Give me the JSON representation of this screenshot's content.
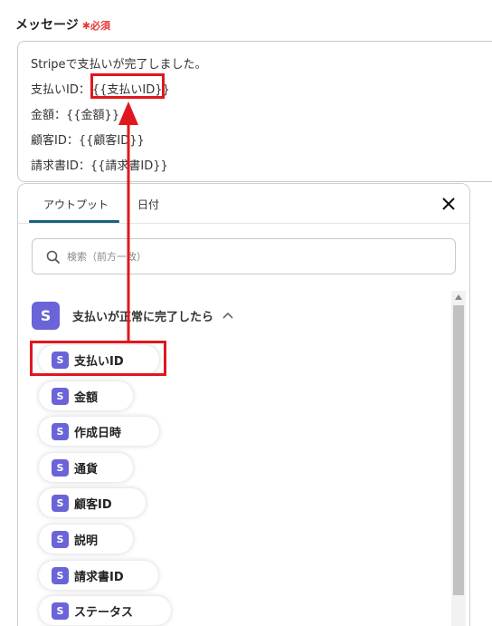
{
  "field": {
    "label": "メッセージ",
    "required_mark": "✱",
    "required_text": "必須"
  },
  "message": {
    "lines": [
      {
        "label": "Stripeで支払いが完了しました。",
        "token": ""
      },
      {
        "label": "支払いID：",
        "token": "{{支払いID}}"
      },
      {
        "label": "金額：",
        "token": "{{金額}}"
      },
      {
        "label": "顧客ID：",
        "token": "{{顧客ID}}"
      },
      {
        "label": "請求書ID：",
        "token": "{{請求書ID}}"
      }
    ]
  },
  "popup": {
    "tabs": [
      {
        "label": "アウトプット",
        "active": true
      },
      {
        "label": "日付",
        "active": false
      }
    ],
    "close_icon": "close-icon",
    "search": {
      "placeholder": "検索（前方一致）",
      "value": ""
    },
    "group": {
      "badge": "S",
      "title": "支払いが正常に完了したら",
      "expanded": true
    },
    "items": [
      {
        "badge": "S",
        "label": "支払いID"
      },
      {
        "badge": "S",
        "label": "金額"
      },
      {
        "badge": "S",
        "label": "作成日時"
      },
      {
        "badge": "S",
        "label": "通貨"
      },
      {
        "badge": "S",
        "label": "顧客ID"
      },
      {
        "badge": "S",
        "label": "説明"
      },
      {
        "badge": "S",
        "label": "請求書ID"
      },
      {
        "badge": "S",
        "label": "ステータス"
      }
    ]
  },
  "colors": {
    "accent": "#6a64d8",
    "highlight": "#e0171e",
    "tab_active": "#1f5f80",
    "required": "#e53935"
  }
}
